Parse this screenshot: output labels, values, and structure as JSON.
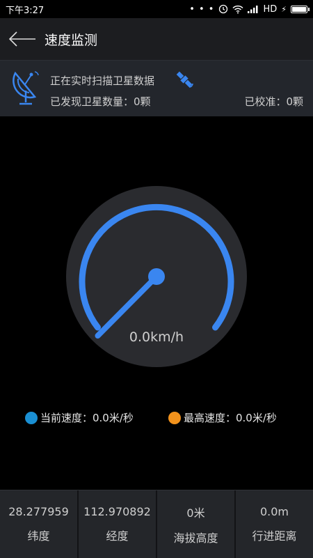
{
  "status_bar": {
    "time": "下午3:27",
    "dots": "• • •",
    "network": "HD",
    "charging": "⚡"
  },
  "header": {
    "title": "速度监测"
  },
  "satellite_panel": {
    "scanning_text": "正在实时扫描卫星数据",
    "found_text": "已发现卫星数量：0颗",
    "calibrated_text": "已校准：0颗"
  },
  "gauge": {
    "speed_text": "0.0km/h",
    "speed_value": 0.0,
    "arc_color": "#3a86f0",
    "dial_color": "#2a2b2f"
  },
  "legend": {
    "current_label": "当前速度：0.0米/秒",
    "current_color": "#1a8fd3",
    "max_label": "最高速度：0.0米/秒",
    "max_color": "#f2921c"
  },
  "stats": [
    {
      "value": "28.277959",
      "label": "纬度"
    },
    {
      "value": "112.970892",
      "label": "经度"
    },
    {
      "value": "0米",
      "label": "海拔高度"
    },
    {
      "value": "0.0m",
      "label": "行进距离"
    }
  ]
}
